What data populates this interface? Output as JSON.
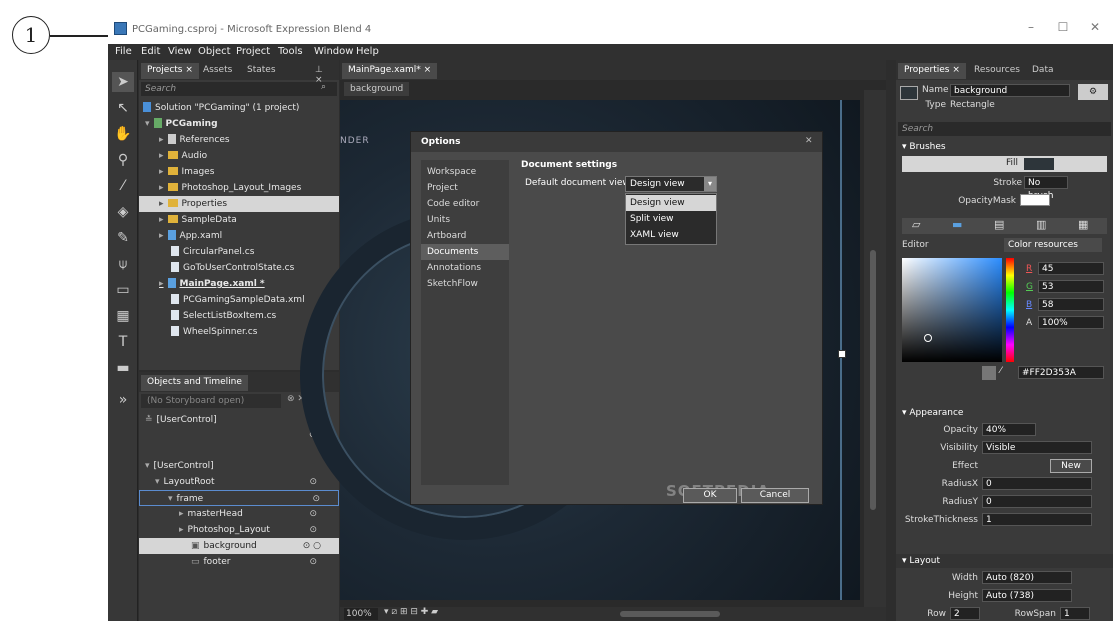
{
  "callout": {
    "number": "1"
  },
  "window": {
    "title": "PCGaming.csproj - Microsoft Expression Blend 4",
    "controls": {
      "minimize": "–",
      "maximize": "☐",
      "close": "✕"
    }
  },
  "menu": [
    "File",
    "Edit",
    "View",
    "Object",
    "Project",
    "Tools",
    "Window",
    "Help"
  ],
  "projects_panel": {
    "tabs": [
      "Projects",
      "Assets",
      "States"
    ],
    "search_placeholder": "Search",
    "tree": [
      {
        "label": "Solution \"PCGaming\" (1 project)",
        "kind": "solution",
        "bold": false
      },
      {
        "label": "PCGaming",
        "kind": "project",
        "bold": true
      },
      {
        "label": "References",
        "kind": "references"
      },
      {
        "label": "Audio",
        "kind": "folder"
      },
      {
        "label": "Images",
        "kind": "folder"
      },
      {
        "label": "Photoshop_Layout_Images",
        "kind": "folder"
      },
      {
        "label": "Properties",
        "kind": "folder",
        "selected": true
      },
      {
        "label": "SampleData",
        "kind": "folder"
      },
      {
        "label": "App.xaml",
        "kind": "xaml"
      },
      {
        "label": "CircularPanel.cs",
        "kind": "cs"
      },
      {
        "label": "GoToUserControlState.cs",
        "kind": "cs"
      },
      {
        "label": "MainPage.xaml *",
        "kind": "xaml",
        "bold": true
      },
      {
        "label": "PCGamingSampleData.xml",
        "kind": "xml"
      },
      {
        "label": "SelectListBoxItem.cs",
        "kind": "cs"
      },
      {
        "label": "WheelSpinner.cs",
        "kind": "cs"
      }
    ]
  },
  "objects_panel": {
    "title": "Objects and Timeline",
    "storyboard": "(No Storyboard open)",
    "root_label": "[UserControl]",
    "tree": [
      {
        "label": "[UserControl]"
      },
      {
        "label": "LayoutRoot"
      },
      {
        "label": "frame"
      },
      {
        "label": "masterHead"
      },
      {
        "label": "Photoshop_Layout"
      },
      {
        "label": "background"
      },
      {
        "label": "footer"
      }
    ]
  },
  "document": {
    "tab": "MainPage.xaml*",
    "breadcrumb": "background",
    "zoom": "100%",
    "canvas_text": "NDER"
  },
  "options_dialog": {
    "title": "Options",
    "nav": [
      "Workspace",
      "Project",
      "Code editor",
      "Units",
      "Artboard",
      "Documents",
      "Annotations",
      "SketchFlow"
    ],
    "selected_nav": "Documents",
    "section_title": "Document settings",
    "default_view_label": "Default document view",
    "default_view_value": "Design view",
    "options": [
      "Design view",
      "Split view",
      "XAML view"
    ],
    "ok_label": "OK",
    "cancel_label": "Cancel",
    "watermark": "SOFTPEDIA"
  },
  "properties_panel": {
    "tabs": [
      "Properties",
      "Resources",
      "Data"
    ],
    "name_label": "Name",
    "name_value": "background",
    "type_label": "Type",
    "type_value": "Rectangle",
    "search_placeholder": "Search",
    "brushes": {
      "title": "Brushes",
      "fill": "Fill",
      "stroke": "Stroke",
      "stroke_value": "No brush",
      "opacity_mask": "OpacityMask",
      "editor_label": "Editor",
      "color_resources": "Color resources",
      "r_label": "R",
      "r": "45",
      "g_label": "G",
      "g": "53",
      "b_label": "B",
      "b": "58",
      "a_label": "A",
      "a": "100%",
      "hex": "#FF2D353A"
    },
    "appearance": {
      "title": "Appearance",
      "opacity_label": "Opacity",
      "opacity": "40%",
      "visibility_label": "Visibility",
      "visibility": "Visible",
      "effect_label": "Effect",
      "new_label": "New",
      "radiusx_label": "RadiusX",
      "radiusx": "0",
      "radiusy_label": "RadiusY",
      "radiusy": "0",
      "stroke_label": "StrokeThickness",
      "stroke": "1"
    },
    "layout": {
      "title": "Layout",
      "width_label": "Width",
      "width": "Auto (820)",
      "height_label": "Height",
      "height": "Auto (738)",
      "row_label": "Row",
      "row": "2",
      "rowspan_label": "RowSpan",
      "rowspan": "1"
    }
  },
  "colors": {
    "accent": "#2d353a",
    "selection": "#d6d6d6"
  }
}
